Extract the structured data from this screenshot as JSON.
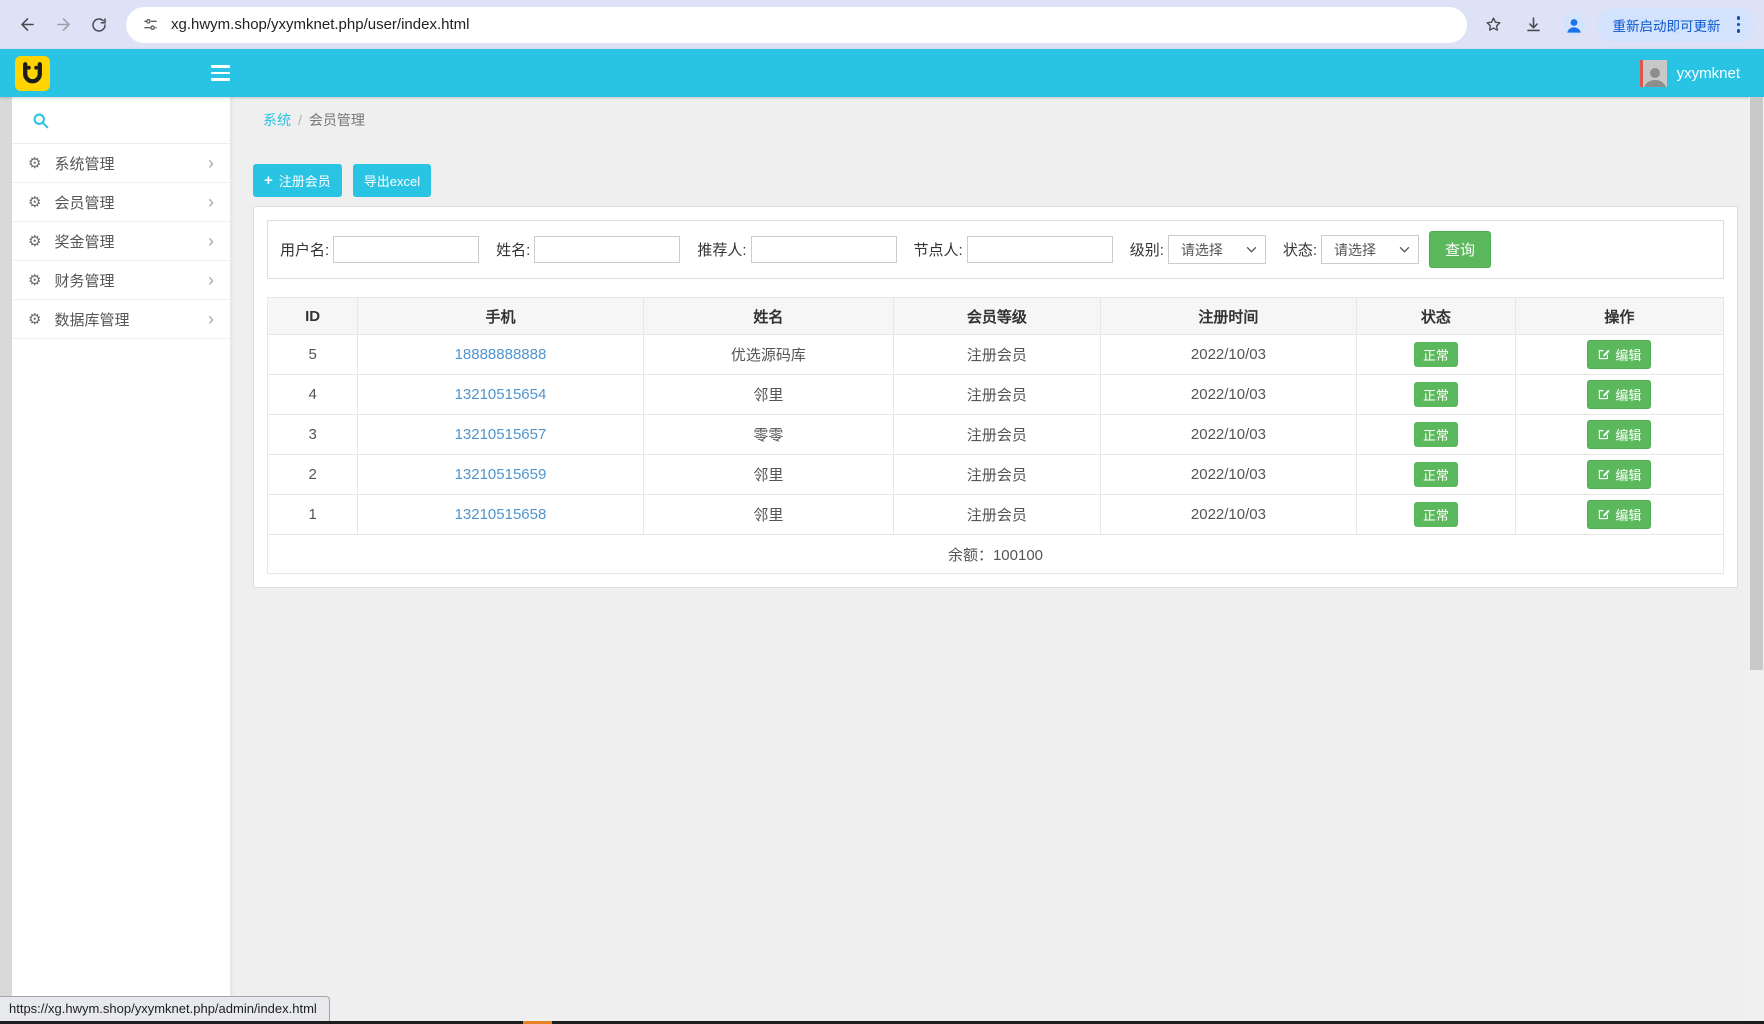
{
  "browser": {
    "url": "xg.hwym.shop/yxymknet.php/user/index.html",
    "update_button_label": "重新启动即可更新",
    "status_link": "https://xg.hwym.shop/yxymknet.php/admin/index.html"
  },
  "app_header": {
    "username": "yxymknet"
  },
  "sidebar": {
    "items": [
      {
        "label": "系统管理"
      },
      {
        "label": "会员管理"
      },
      {
        "label": "奖金管理"
      },
      {
        "label": "财务管理"
      },
      {
        "label": "数据库管理"
      }
    ]
  },
  "breadcrumb": {
    "root": "系统",
    "separator": "/",
    "current": "会员管理"
  },
  "toolbar": {
    "register_label": "注册会员",
    "export_label": "导出excel"
  },
  "filters": {
    "username_label": "用户名:",
    "name_label": "姓名:",
    "referrer_label": "推荐人:",
    "node_label": "节点人:",
    "level_label": "级别:",
    "level_value": "请选择",
    "status_label": "状态:",
    "status_value": "请选择",
    "search_label": "查询"
  },
  "table": {
    "headers": [
      "ID",
      "手机",
      "姓名",
      "会员等级",
      "注册时间",
      "状态",
      "操作"
    ],
    "rows": [
      {
        "id": "5",
        "phone": "18888888888",
        "name": "优选源码库",
        "level": "注册会员",
        "reg_date": "2022/10/03",
        "status": "正常",
        "action": "编辑"
      },
      {
        "id": "4",
        "phone": "13210515654",
        "name": "邻里",
        "level": "注册会员",
        "reg_date": "2022/10/03",
        "status": "正常",
        "action": "编辑"
      },
      {
        "id": "3",
        "phone": "13210515657",
        "name": "零零",
        "level": "注册会员",
        "reg_date": "2022/10/03",
        "status": "正常",
        "action": "编辑"
      },
      {
        "id": "2",
        "phone": "13210515659",
        "name": "邻里",
        "level": "注册会员",
        "reg_date": "2022/10/03",
        "status": "正常",
        "action": "编辑"
      },
      {
        "id": "1",
        "phone": "13210515658",
        "name": "邻里",
        "level": "注册会员",
        "reg_date": "2022/10/03",
        "status": "正常",
        "action": "编辑"
      }
    ],
    "balance_label": "余额：",
    "balance_value": "100100"
  },
  "colors": {
    "accent_cyan": "#29c3e4",
    "success_green": "#5cb85c",
    "link_blue": "#5094ce",
    "logo_yellow": "#ffd400",
    "update_pill_text": "#0b57d0"
  }
}
